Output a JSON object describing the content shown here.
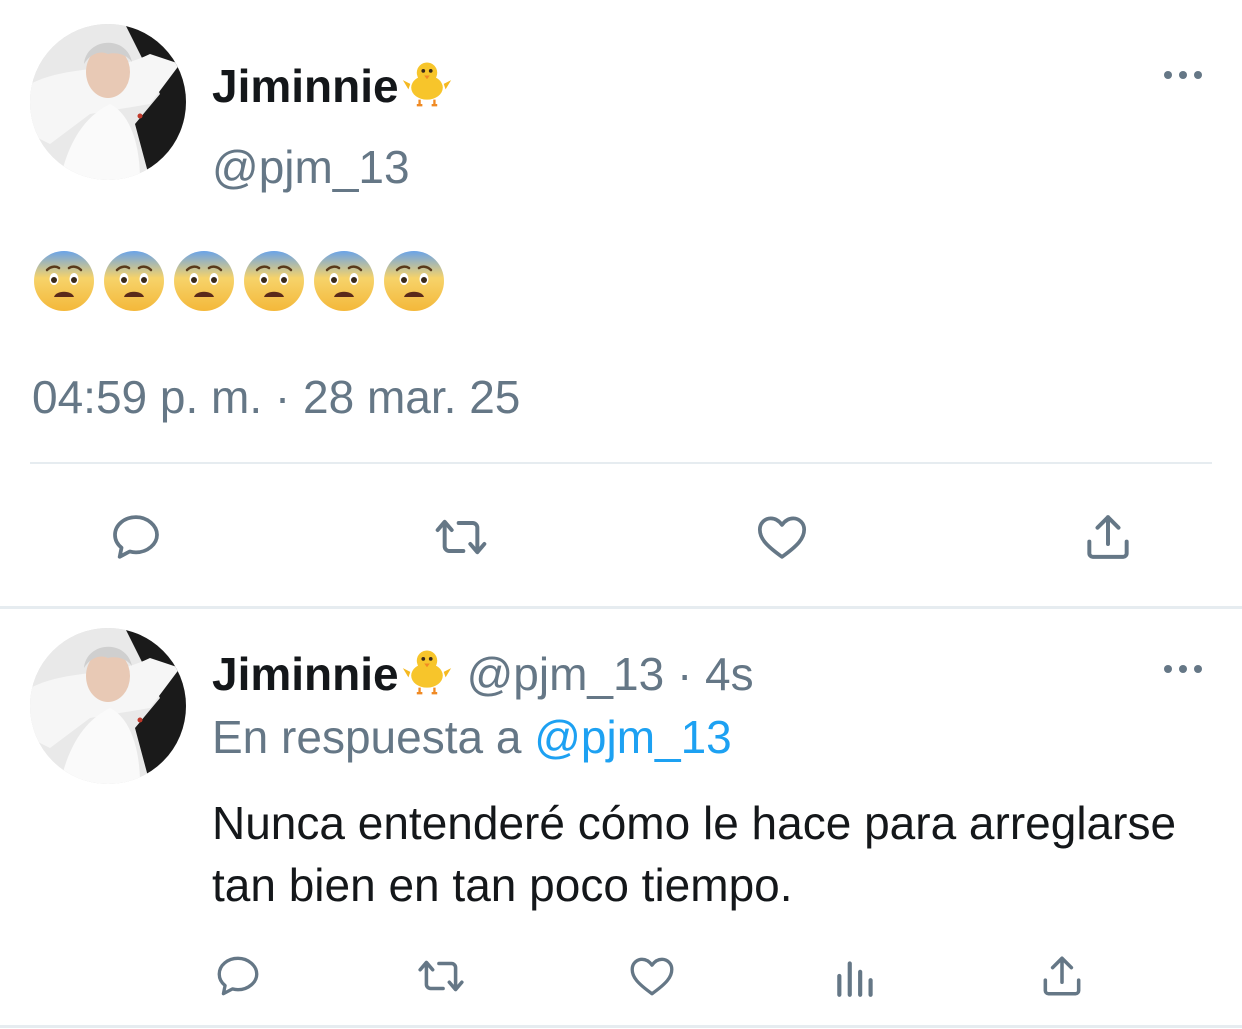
{
  "main_tweet": {
    "display_name": "Jiminnie",
    "name_emoji": "chick-emoji",
    "handle": "@pjm_13",
    "body_emojis": [
      "fearful-face-emoji",
      "fearful-face-emoji",
      "fearful-face-emoji",
      "fearful-face-emoji",
      "fearful-face-emoji",
      "fearful-face-emoji"
    ],
    "timestamp": "04:59 p. m. · 28 mar. 25",
    "actions": [
      "reply-icon",
      "retweet-icon",
      "like-icon",
      "share-icon"
    ]
  },
  "reply_tweet": {
    "display_name": "Jiminnie",
    "name_emoji": "chick-emoji",
    "meta": "@pjm_13 · 4s",
    "in_reply_prefix": "En respuesta a",
    "in_reply_mention": "@pjm_13",
    "text": "Nunca entenderé cómo le hace para arreglarse tan bien en tan poco tiempo.",
    "actions": [
      "reply-icon",
      "retweet-icon",
      "like-icon",
      "analytics-icon",
      "share-icon"
    ]
  },
  "colors": {
    "text": "#14171a",
    "secondary": "#657786",
    "link": "#1da1f2",
    "divider": "#e6ecf0"
  }
}
